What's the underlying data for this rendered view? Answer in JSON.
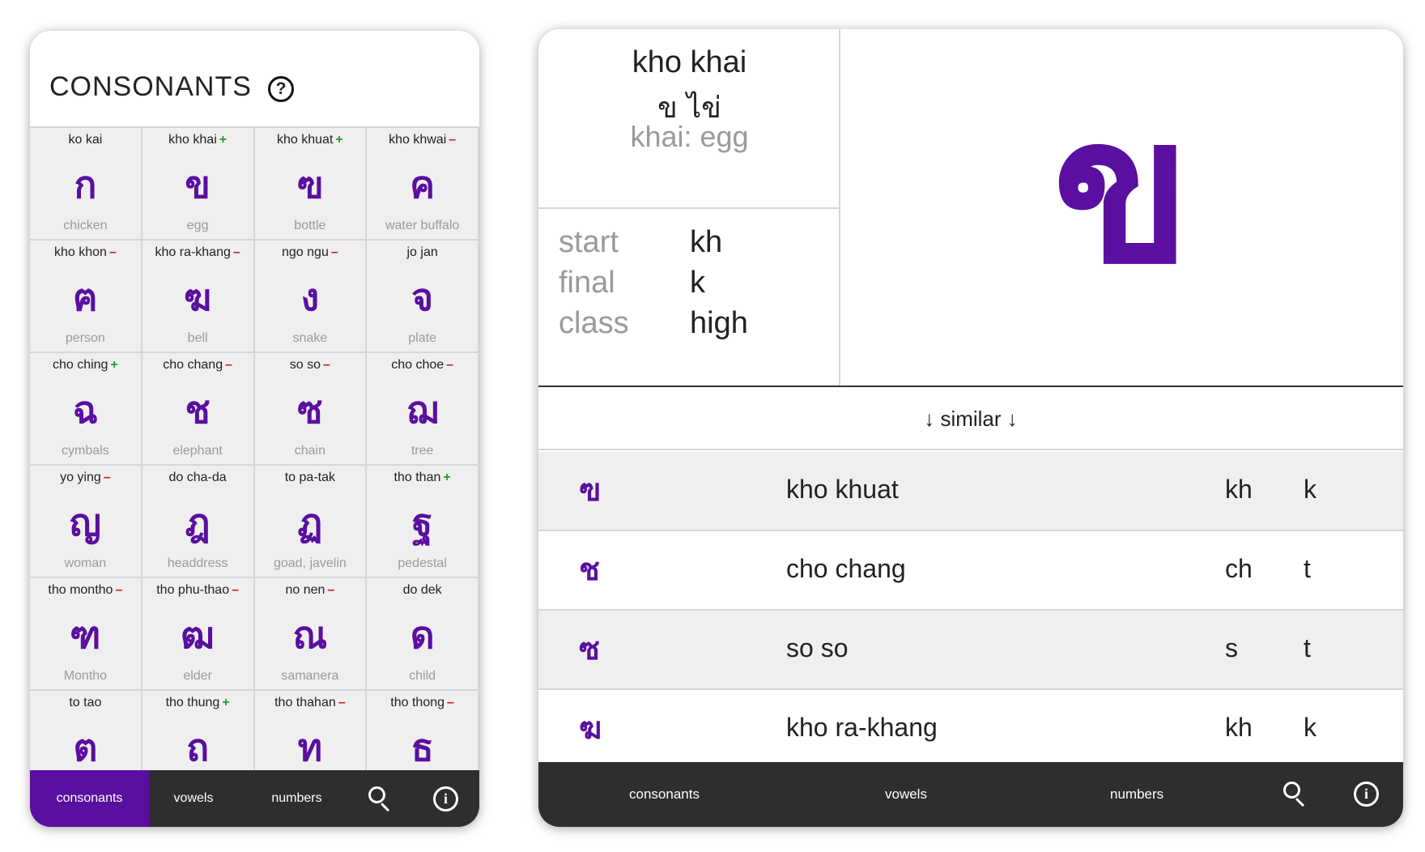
{
  "left": {
    "title": "CONSONANTS",
    "help_glyph": "?",
    "cells": [
      {
        "name": "ko kai",
        "mark": "",
        "char": "ก",
        "meaning": "chicken"
      },
      {
        "name": "kho khai",
        "mark": "+",
        "char": "ข",
        "meaning": "egg"
      },
      {
        "name": "kho khuat",
        "mark": "+",
        "char": "ฃ",
        "meaning": "bottle"
      },
      {
        "name": "kho khwai",
        "mark": "–",
        "char": "ค",
        "meaning": "water buffalo"
      },
      {
        "name": "kho khon",
        "mark": "–",
        "char": "ฅ",
        "meaning": "person"
      },
      {
        "name": "kho ra-khang",
        "mark": "–",
        "char": "ฆ",
        "meaning": "bell"
      },
      {
        "name": "ngo ngu",
        "mark": "–",
        "char": "ง",
        "meaning": "snake"
      },
      {
        "name": "jo jan",
        "mark": "",
        "char": "จ",
        "meaning": "plate"
      },
      {
        "name": "cho ching",
        "mark": "+",
        "char": "ฉ",
        "meaning": "cymbals"
      },
      {
        "name": "cho chang",
        "mark": "–",
        "char": "ช",
        "meaning": "elephant"
      },
      {
        "name": "so so",
        "mark": "–",
        "char": "ซ",
        "meaning": "chain"
      },
      {
        "name": "cho choe",
        "mark": "–",
        "char": "ฌ",
        "meaning": "tree"
      },
      {
        "name": "yo ying",
        "mark": "–",
        "char": "ญ",
        "meaning": "woman"
      },
      {
        "name": "do cha-da",
        "mark": "",
        "char": "ฎ",
        "meaning": "headdress"
      },
      {
        "name": "to pa-tak",
        "mark": "",
        "char": "ฏ",
        "meaning": "goad, javelin"
      },
      {
        "name": "tho than",
        "mark": "+",
        "char": "ฐ",
        "meaning": "pedestal"
      },
      {
        "name": "tho montho",
        "mark": "–",
        "char": "ฑ",
        "meaning": "Montho"
      },
      {
        "name": "tho phu-thao",
        "mark": "–",
        "char": "ฒ",
        "meaning": "elder"
      },
      {
        "name": "no nen",
        "mark": "–",
        "char": "ณ",
        "meaning": "samanera"
      },
      {
        "name": "do dek",
        "mark": "",
        "char": "ด",
        "meaning": "child"
      },
      {
        "name": "to tao",
        "mark": "",
        "char": "ต",
        "meaning": ""
      },
      {
        "name": "tho thung",
        "mark": "+",
        "char": "ถ",
        "meaning": ""
      },
      {
        "name": "tho thahan",
        "mark": "–",
        "char": "ท",
        "meaning": ""
      },
      {
        "name": "tho thong",
        "mark": "–",
        "char": "ธ",
        "meaning": ""
      }
    ],
    "nav": {
      "consonants": "consonants",
      "vowels": "vowels",
      "numbers": "numbers",
      "info": "i"
    }
  },
  "right": {
    "name": "kho khai",
    "thai": "ข ไข่",
    "meaning": "khai: egg",
    "props": [
      {
        "label": "start",
        "value": "kh"
      },
      {
        "label": "final",
        "value": "k"
      },
      {
        "label": "class",
        "value": "high"
      }
    ],
    "big_char": "ข",
    "similar_label": "↓ similar ↓",
    "similar": [
      {
        "char": "ฃ",
        "name": "kho khuat",
        "start": "kh",
        "final": "k"
      },
      {
        "char": "ช",
        "name": "cho chang",
        "start": "ch",
        "final": "t"
      },
      {
        "char": "ซ",
        "name": "so so",
        "start": "s",
        "final": "t"
      },
      {
        "char": "ฆ",
        "name": "kho ra-khang",
        "start": "kh",
        "final": "k"
      }
    ],
    "nav": {
      "consonants": "consonants",
      "vowels": "vowels",
      "numbers": "numbers",
      "info": "i"
    }
  },
  "colors": {
    "accent": "#5a0fa0",
    "nav_bg": "#2e2e2e",
    "plus": "#1e9e2a",
    "minus": "#d21b1b"
  }
}
